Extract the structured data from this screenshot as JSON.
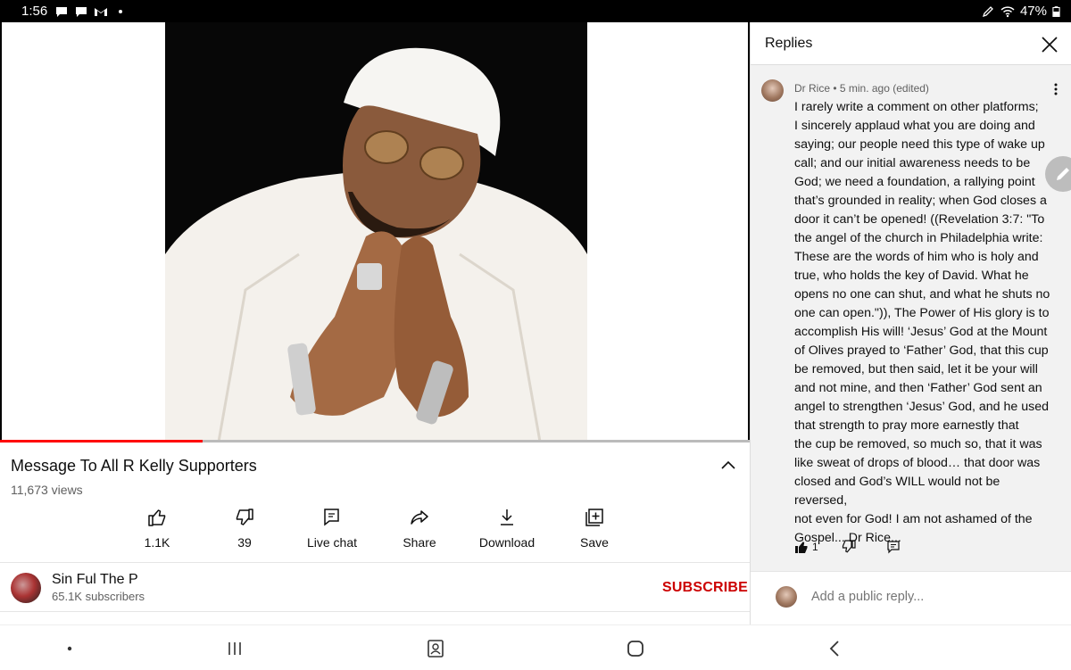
{
  "status_bar": {
    "time": "1:56",
    "battery": "47%"
  },
  "video": {
    "title": "Message To All R Kelly Supporters",
    "views": "11,673 views",
    "progress_fraction": 0.27
  },
  "actions": [
    {
      "name": "like",
      "label": "1.1K",
      "icon": "thumbs-up-icon"
    },
    {
      "name": "dislike",
      "label": "39",
      "icon": "thumbs-down-icon"
    },
    {
      "name": "live-chat",
      "label": "Live chat",
      "icon": "chat-icon"
    },
    {
      "name": "share",
      "label": "Share",
      "icon": "share-icon"
    },
    {
      "name": "download",
      "label": "Download",
      "icon": "download-icon"
    },
    {
      "name": "save",
      "label": "Save",
      "icon": "add-to-playlist-icon"
    }
  ],
  "channel": {
    "name": "Sin Ful The P",
    "subscribers": "65.1K subscribers",
    "subscribe_label": "SUBSCRIBE"
  },
  "replies": {
    "header": "Replies",
    "comment": {
      "author": "Dr Rice",
      "meta": "Dr Rice • 5 min. ago (edited)",
      "lines": [
        "I rarely write a comment on other platforms;",
        "I sincerely applaud what you are doing and",
        "saying; our people need this type of wake up",
        "call; and our initial awareness needs to be",
        "God; we need a foundation, a rallying point",
        "that’s grounded in reality; when God closes a",
        "door it can’t be opened! ((Revelation 3:7: \"To",
        "the angel of the church in Philadelphia write:",
        "These are the words of him who is holy and",
        "true, who holds the key of David. What he",
        "opens no one can shut, and what he shuts no",
        "one can open.\")), The Power of His glory is to",
        "accomplish His will! ‘Jesus’ God at the Mount",
        "of Olives prayed to ‘Father’ God, that this cup",
        "be removed, but then said, let it be your will",
        "and not mine, and then ‘Father’ God sent an",
        "angel to strengthen ‘Jesus’ God, and he used",
        "that strength to pray more earnestly that",
        "the cup be removed, so much so, that it was",
        "like sweat of drops of blood… that door was",
        "closed and God’s WILL would not be reversed,",
        "not even for God! I am not ashamed of the",
        "Gospel... Dr Rice..."
      ],
      "likes": "1"
    },
    "reply_placeholder": "Add a public reply..."
  }
}
